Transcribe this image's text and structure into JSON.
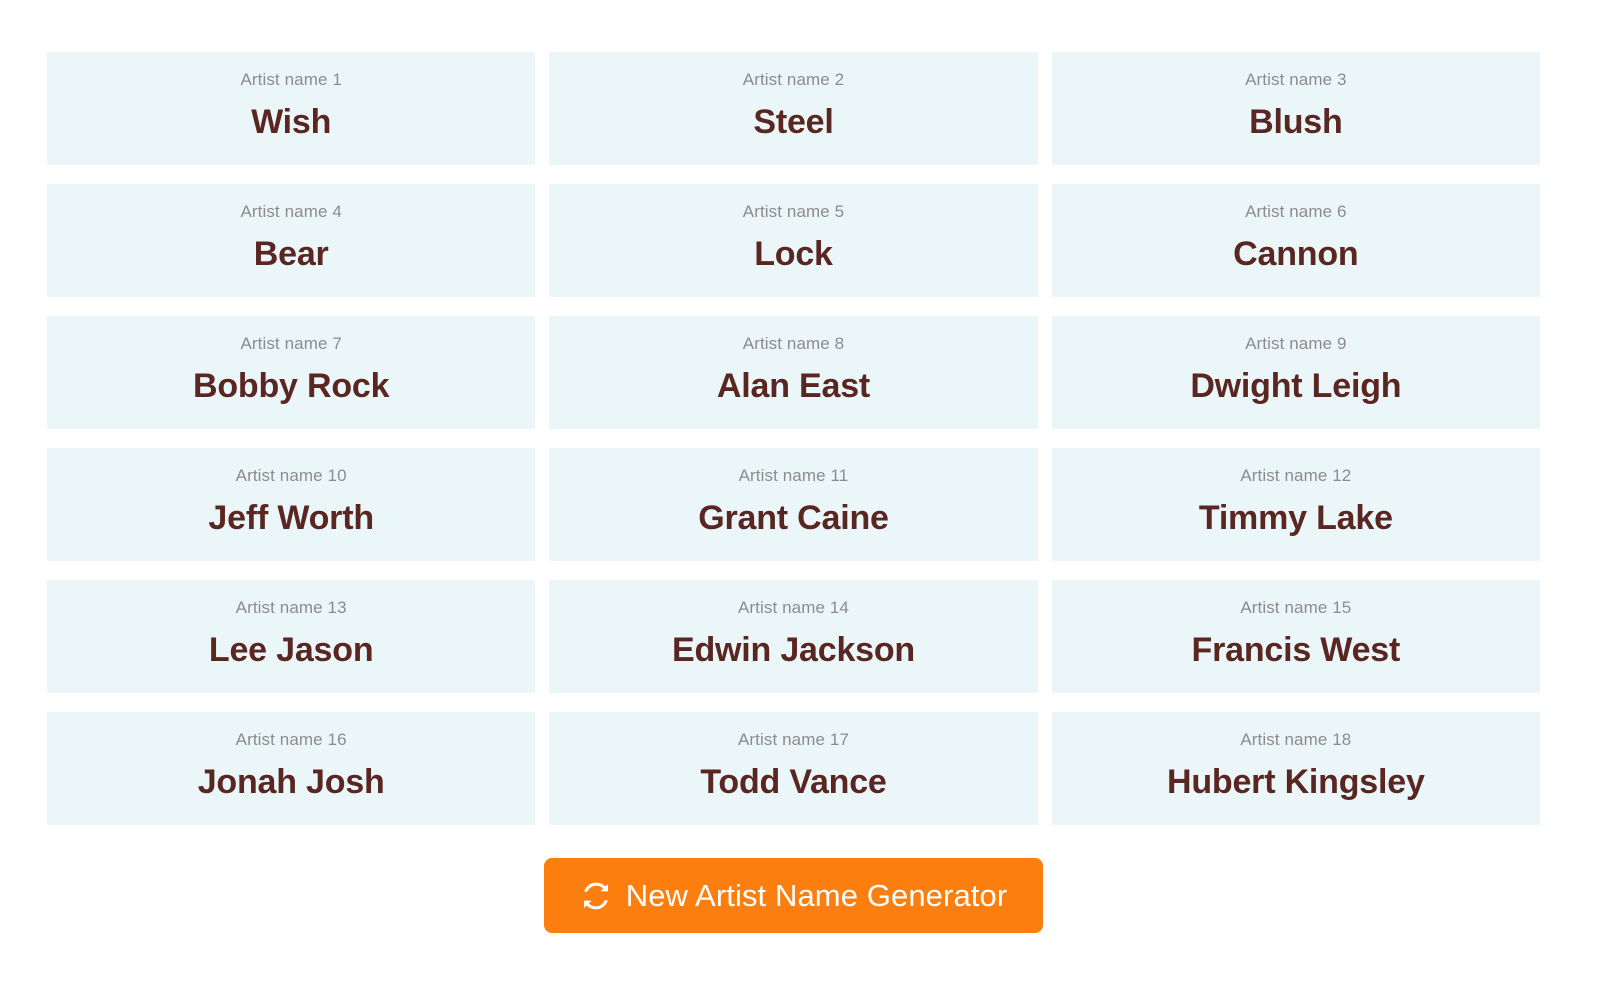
{
  "page": {
    "background_color": "#ffffff",
    "card_background_color": "#ebf6f9",
    "label_color": "#8c8c8c",
    "name_color": "#5a2622",
    "accent_color": "#fc7e0f"
  },
  "cards": [
    {
      "label": "Artist name 1",
      "name": "Wish"
    },
    {
      "label": "Artist name 2",
      "name": "Steel"
    },
    {
      "label": "Artist name 3",
      "name": "Blush"
    },
    {
      "label": "Artist name 4",
      "name": "Bear"
    },
    {
      "label": "Artist name 5",
      "name": "Lock"
    },
    {
      "label": "Artist name 6",
      "name": "Cannon"
    },
    {
      "label": "Artist name 7",
      "name": "Bobby Rock"
    },
    {
      "label": "Artist name 8",
      "name": "Alan East"
    },
    {
      "label": "Artist name 9",
      "name": "Dwight Leigh"
    },
    {
      "label": "Artist name 10",
      "name": "Jeff Worth"
    },
    {
      "label": "Artist name 11",
      "name": "Grant Caine"
    },
    {
      "label": "Artist name 12",
      "name": "Timmy Lake"
    },
    {
      "label": "Artist name 13",
      "name": "Lee Jason"
    },
    {
      "label": "Artist name 14",
      "name": "Edwin Jackson"
    },
    {
      "label": "Artist name 15",
      "name": "Francis West"
    },
    {
      "label": "Artist name 16",
      "name": "Jonah Josh"
    },
    {
      "label": "Artist name 17",
      "name": "Todd Vance"
    },
    {
      "label": "Artist name 18",
      "name": "Hubert Kingsley"
    }
  ],
  "generate_button": {
    "label": "New Artist Name Generator",
    "icon": "sync-icon",
    "color": "#fc7e0f",
    "text_color": "#ffffff"
  }
}
